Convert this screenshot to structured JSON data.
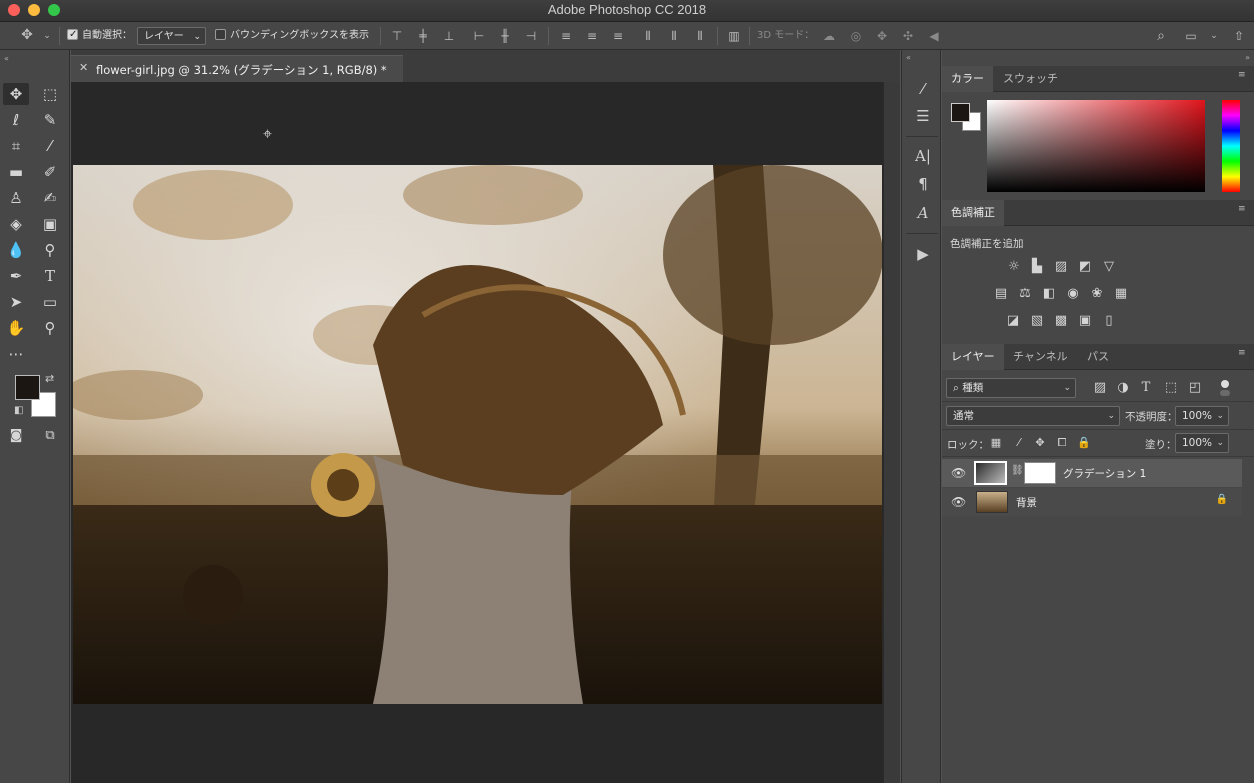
{
  "window": {
    "title": "Adobe Photoshop CC 2018"
  },
  "options_bar": {
    "auto_select_label": "自動選択：",
    "auto_select_value": "レイヤー",
    "show_bbox_label": "バウンディングボックスを表示",
    "mode_3d_label": "3D モード："
  },
  "document": {
    "tab_title": "flower-girl.jpg @ 31.2% (グラデーション 1, RGB/8) *"
  },
  "color_panel": {
    "tabs": [
      "カラー",
      "スウォッチ"
    ],
    "foreground": "#1b1612",
    "background": "#ffffff"
  },
  "adjustments_panel": {
    "tab": "色調補正",
    "add_label": "色調補正を追加"
  },
  "layers_panel": {
    "tabs": [
      "レイヤー",
      "チャンネル",
      "パス"
    ],
    "filter_kind": "種類",
    "blend_mode": "通常",
    "opacity_label": "不透明度：",
    "opacity_value": "100%",
    "lock_label": "ロック：",
    "fill_label": "塗り：",
    "fill_value": "100%",
    "layers": [
      {
        "name": "グラデーション 1",
        "selected": true
      },
      {
        "name": "背景",
        "selected": false
      }
    ]
  },
  "colors": {
    "accent_selected_row": "#5a5a5a",
    "canvas_bg": "#282828"
  }
}
